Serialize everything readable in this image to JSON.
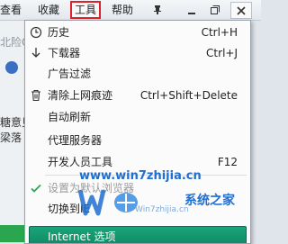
{
  "menubar": {
    "items": [
      {
        "label": "查看"
      },
      {
        "label": "收藏"
      },
      {
        "label": "工具"
      },
      {
        "label": "帮助"
      }
    ],
    "window_buttons": {
      "pin": "pin-icon",
      "minimize": "minimize-icon",
      "restore": "restore-icon",
      "close": "close-icon"
    }
  },
  "left_page": {
    "line1": "北险O",
    "line2": "糖意见",
    "line3": "梁落"
  },
  "tools_menu": {
    "items": [
      {
        "label": "历史",
        "shortcut": "Ctrl+H",
        "icon": "clock-icon"
      },
      {
        "label": "下载器",
        "shortcut": "Ctrl+J",
        "icon": "download-arrow-icon"
      },
      {
        "label": "广告过滤",
        "shortcut": ""
      },
      {
        "label": "清除上网痕迹",
        "shortcut": "Ctrl+Shift+Delete",
        "icon": "trash-icon"
      },
      {
        "label": "自动刷新",
        "shortcut": "",
        "submenu": true
      },
      {
        "label": "代理服务器",
        "shortcut": "",
        "submenu": true
      },
      {
        "label": "开发人员工具",
        "shortcut": "F12"
      },
      {
        "label": "设置为默认浏览器",
        "shortcut": "",
        "checked": true,
        "disabled": true
      },
      {
        "label": "切换到IE",
        "shortcut": ""
      },
      {
        "label": "Internet 选项",
        "shortcut": "",
        "selected": true
      }
    ]
  },
  "watermark": {
    "url": "www.win7zhijia.cn",
    "brand": "系统之家",
    "sub": "Win7zhijia.cn"
  },
  "colors": {
    "highlight": "#e0202a",
    "selected_bg": "#0d8a62",
    "watermark": "#1f6fd0"
  }
}
